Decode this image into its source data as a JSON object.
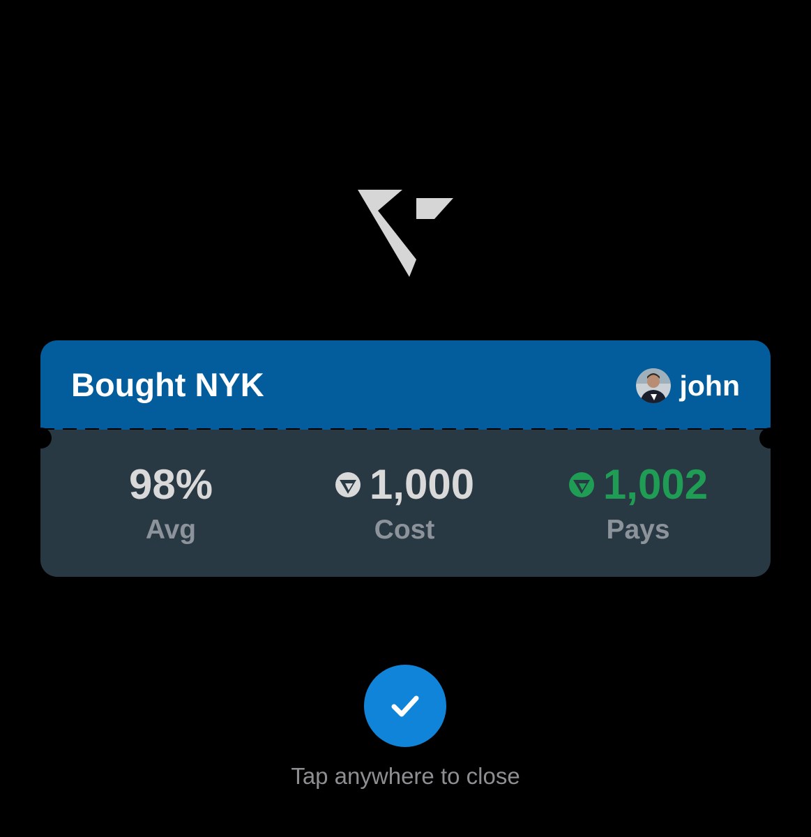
{
  "colors": {
    "background": "#000000",
    "ticket_header": "#035d9c",
    "ticket_body": "#293944",
    "value_default": "#d9d9d9",
    "value_positive": "#1f9d55",
    "label": "#8c939a",
    "confirm_button": "#0f84d8",
    "hint_text": "#8e8e93"
  },
  "logo": {
    "icon": "app-logo-icon"
  },
  "ticket": {
    "title": "Bought NYK",
    "user": {
      "name": "john",
      "avatar_icon": "avatar-icon"
    },
    "stats": [
      {
        "value": "98%",
        "label": "Avg",
        "icon": null,
        "tone": "default"
      },
      {
        "value": "1,000",
        "label": "Cost",
        "icon": "coin-icon",
        "tone": "default"
      },
      {
        "value": "1,002",
        "label": "Pays",
        "icon": "coin-icon",
        "tone": "positive"
      }
    ]
  },
  "confirm": {
    "icon": "checkmark-icon"
  },
  "hint": "Tap anywhere to close"
}
